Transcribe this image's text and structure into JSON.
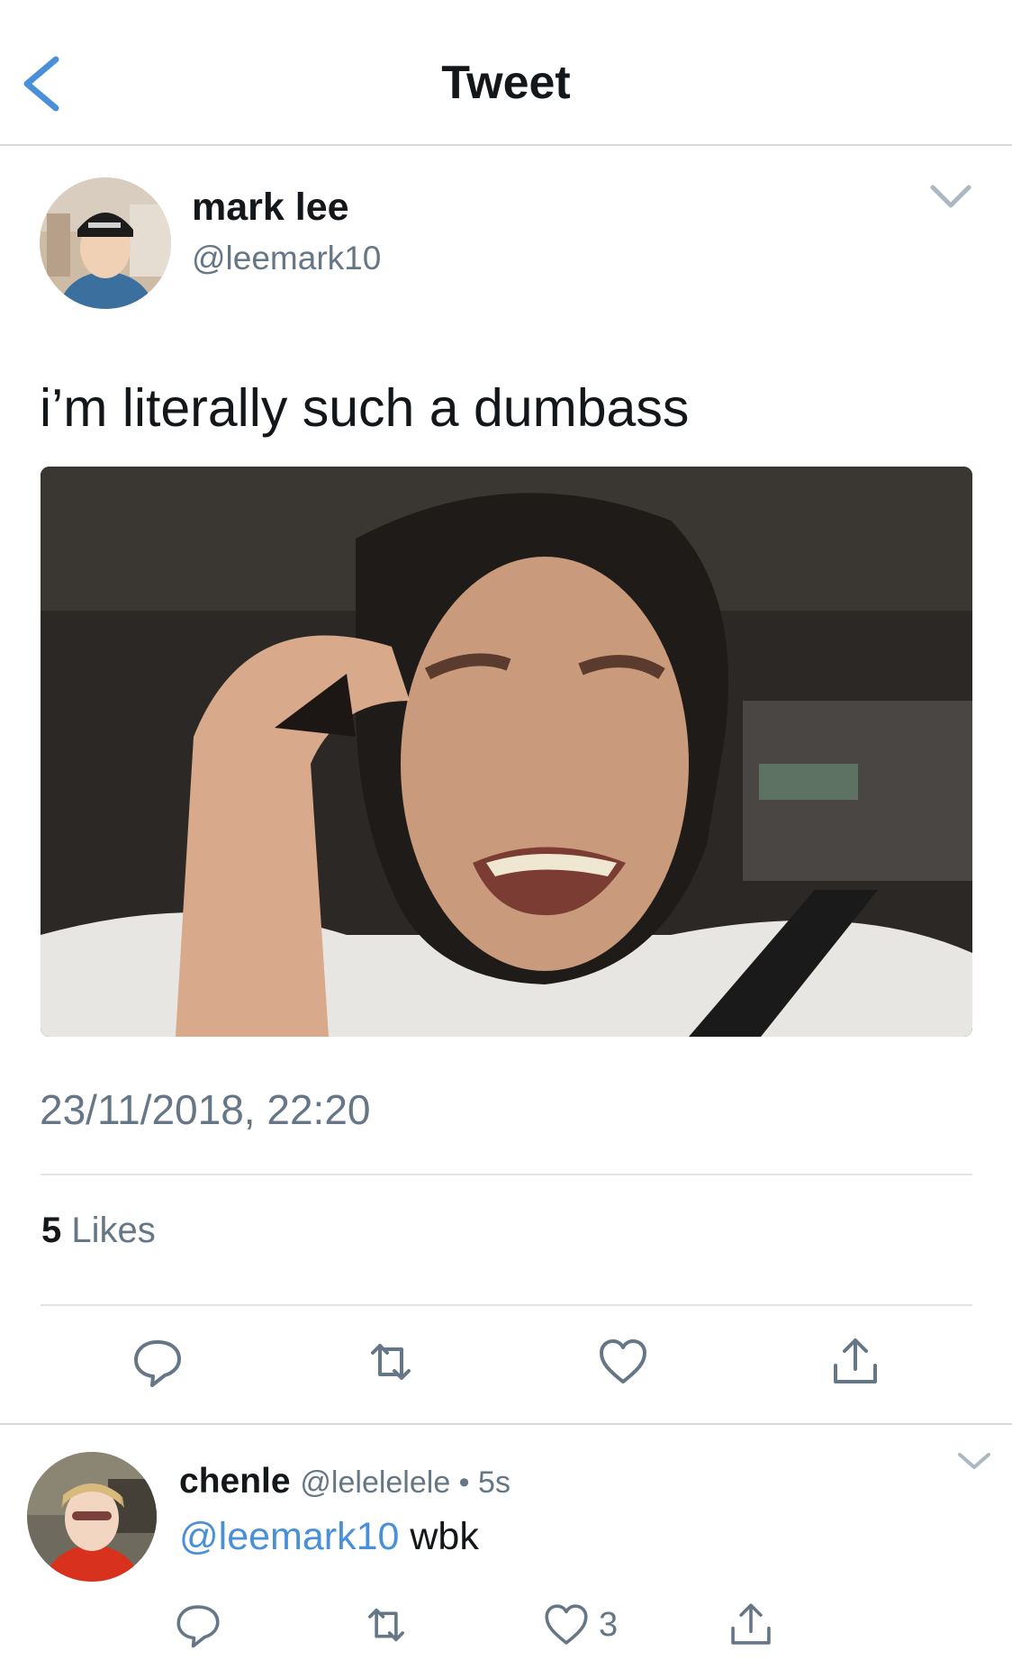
{
  "header": {
    "title": "Tweet",
    "back_icon": "chevron-left-icon",
    "accent": "#4a90d9"
  },
  "tweet": {
    "author": {
      "name": "mark lee",
      "handle": "@leemark10"
    },
    "text": "i’m literally such a dumbass",
    "timestamp": "23/11/2018, 22:20",
    "likes": {
      "count": "5",
      "label": "Likes"
    },
    "actions": [
      "reply-icon",
      "retweet-icon",
      "like-icon",
      "share-icon"
    ]
  },
  "reply": {
    "name": "chenle",
    "meta": "@lelelelele • 5s",
    "mention": "@leemark10",
    "body": "wbk",
    "like_count": "3"
  },
  "colors": {
    "text": "#14171a",
    "secondary": "#657786",
    "link": "#4a90d9",
    "divider": "#e1e5e8"
  }
}
